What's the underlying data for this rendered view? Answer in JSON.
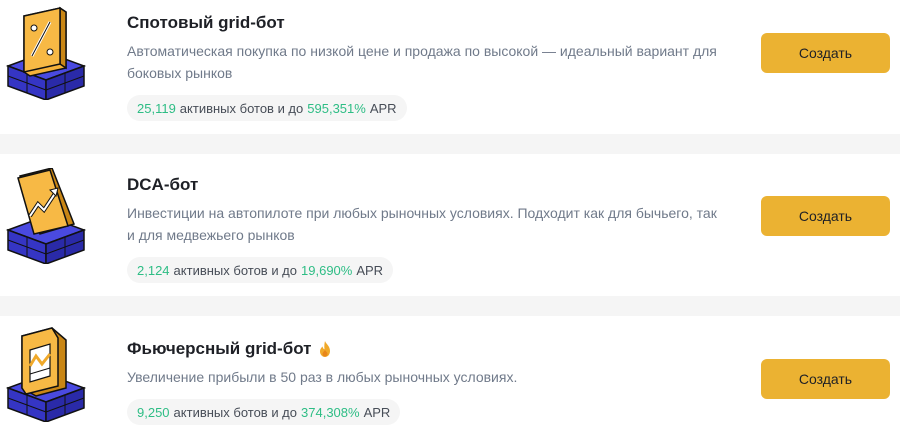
{
  "bots": [
    {
      "title": "Спотовый grid-бот",
      "description": "Автоматическая покупка по низкой цене и продажа по высокой — идеальный вариант для боковых рынков",
      "active_count": "25,119",
      "stats_middle": "активных ботов и до",
      "apr_value": "595,351%",
      "apr_label": "APR",
      "button_label": "Создать",
      "icon": "spot-grid-icon"
    },
    {
      "title": "DCA-бот",
      "description": "Инвестиции на автопилоте при любых рыночных условиях. Подходит как для бычьего, так и для медвежьего рынков",
      "active_count": "2,124",
      "stats_middle": "активных ботов и до",
      "apr_value": "19,690%",
      "apr_label": "APR",
      "button_label": "Создать",
      "icon": "dca-icon"
    },
    {
      "title": "Фьючерсный grid-бот",
      "description": "Увеличение прибыли в 50 раз в любых рыночных условиях.",
      "active_count": "9,250",
      "stats_middle": "активных ботов и до",
      "apr_value": "374,308%",
      "apr_label": "APR",
      "button_label": "Создать",
      "icon": "futures-grid-icon",
      "badge_icon": "fire-icon"
    }
  ],
  "colors": {
    "accent_button": "#ebb232",
    "positive_green": "#2ebd85",
    "illustration_blue": "#3d3dd6",
    "illustration_gold": "#f0a92a"
  }
}
